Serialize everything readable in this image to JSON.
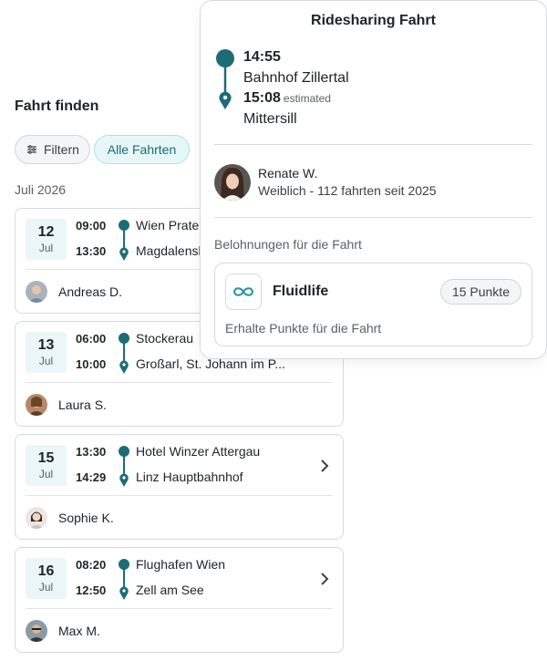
{
  "list": {
    "title": "Fahrt finden",
    "filter_label": "Filtern",
    "all_label": "Alle Fahrten",
    "month": "Juli 2026"
  },
  "trips": [
    {
      "day": "12",
      "month": "Jul",
      "dep_time": "09:00",
      "arr_time": "13:30",
      "from": "Wien Prater",
      "to": "Magdalensberg",
      "driver": "Andreas D.",
      "avatar_color": "#a8b3bd"
    },
    {
      "day": "13",
      "month": "Jul",
      "dep_time": "06:00",
      "arr_time": "10:00",
      "from": "Stockerau",
      "to": "Großarl, St. Johann im P...",
      "driver": "Laura S.",
      "avatar_color": "#b7896a"
    },
    {
      "day": "15",
      "month": "Jul",
      "dep_time": "13:30",
      "arr_time": "14:29",
      "from": "Hotel Winzer Attergau",
      "to": "Linz Hauptbahnhof",
      "driver": "Sophie K.",
      "avatar_color": "#d8cfc8"
    },
    {
      "day": "16",
      "month": "Jul",
      "dep_time": "08:20",
      "arr_time": "12:50",
      "from": "Flughafen Wien",
      "to": "Zell am See",
      "driver": "Max M.",
      "avatar_color": "#8c9aa3"
    }
  ],
  "detail": {
    "title": "Ridesharing Fahrt",
    "dep_time": "14:55",
    "from": "Bahnhof Zillertal",
    "arr_time": "15:08",
    "estimated_label": "estimated",
    "to": "Mittersill",
    "driver_name": "Renate W.",
    "driver_meta": "Weiblich - 112 fahrten seit 2025",
    "rewards_label": "Belohnungen für die Fahrt",
    "reward_name": "Fluidlife",
    "reward_points": "15 Punkte",
    "reward_desc": "Erhalte Punkte für die Fahrt"
  },
  "colors": {
    "accent": "#1e6b78",
    "accent_light": "#e6f7f8",
    "chip_border": "#a9e4e9"
  }
}
